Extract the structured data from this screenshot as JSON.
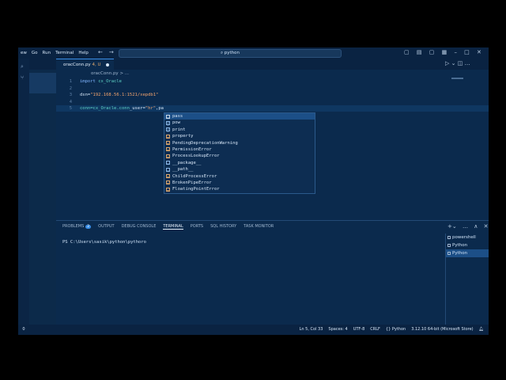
{
  "menu": [
    "ew",
    "Go",
    "Run",
    "Terminal",
    "Help"
  ],
  "search": {
    "text": "python"
  },
  "tab": {
    "filename": "oracConn.py",
    "status": "4, U"
  },
  "breadcrumb": "oracConn.py > ...",
  "code": [
    {
      "ln": "1",
      "parts": [
        [
          "kw",
          "import "
        ],
        [
          "grn",
          "cx_Oracle"
        ]
      ]
    },
    {
      "ln": "2",
      "parts": []
    },
    {
      "ln": "3",
      "parts": [
        [
          "id",
          "dsn="
        ],
        [
          "str",
          "\"192.168.56.1:1521/xepdb1\""
        ]
      ]
    },
    {
      "ln": "4",
      "parts": []
    },
    {
      "ln": "5",
      "parts": [
        [
          "id",
          "conn=cx_Oracle.conn"
        ],
        [
          "id",
          "_user="
        ],
        [
          "str",
          "\"hr\""
        ],
        [
          "id",
          ",pa"
        ]
      ]
    }
  ],
  "suggestions": [
    {
      "label": "pass",
      "kind": "kw"
    },
    {
      "label": "pow",
      "kind": "fn"
    },
    {
      "label": "print",
      "kind": "fn"
    },
    {
      "label": "property",
      "kind": "cls"
    },
    {
      "label": "PendingDeprecationWarning",
      "kind": "cls"
    },
    {
      "label": "PermissionError",
      "kind": "cls"
    },
    {
      "label": "ProcessLookupError",
      "kind": "cls"
    },
    {
      "label": "__package__",
      "kind": "var"
    },
    {
      "label": "__path__",
      "kind": "var"
    },
    {
      "label": "ChildProcessError",
      "kind": "cls"
    },
    {
      "label": "BrokenPipeError",
      "kind": "cls"
    },
    {
      "label": "FloatingPointError",
      "kind": "cls"
    }
  ],
  "panel": {
    "tabs": [
      "PROBLEMS",
      "OUTPUT",
      "DEBUG CONSOLE",
      "TERMINAL",
      "PORTS",
      "SQL HISTORY",
      "TASK MONITOR"
    ],
    "problems_count": "2",
    "active_tab": "TERMINAL",
    "terminal_text": "PS C:\\Users\\sasik\\python\\pythoro",
    "terminals": [
      "powershell",
      "Python",
      "Python"
    ]
  },
  "status": {
    "left": "0",
    "items": [
      "Ln 5, Col 33",
      "Spaces: 4",
      "UTF-8",
      "CRLF",
      "{} Python",
      "3.12.10 64-bit (Microsoft Store)"
    ]
  }
}
